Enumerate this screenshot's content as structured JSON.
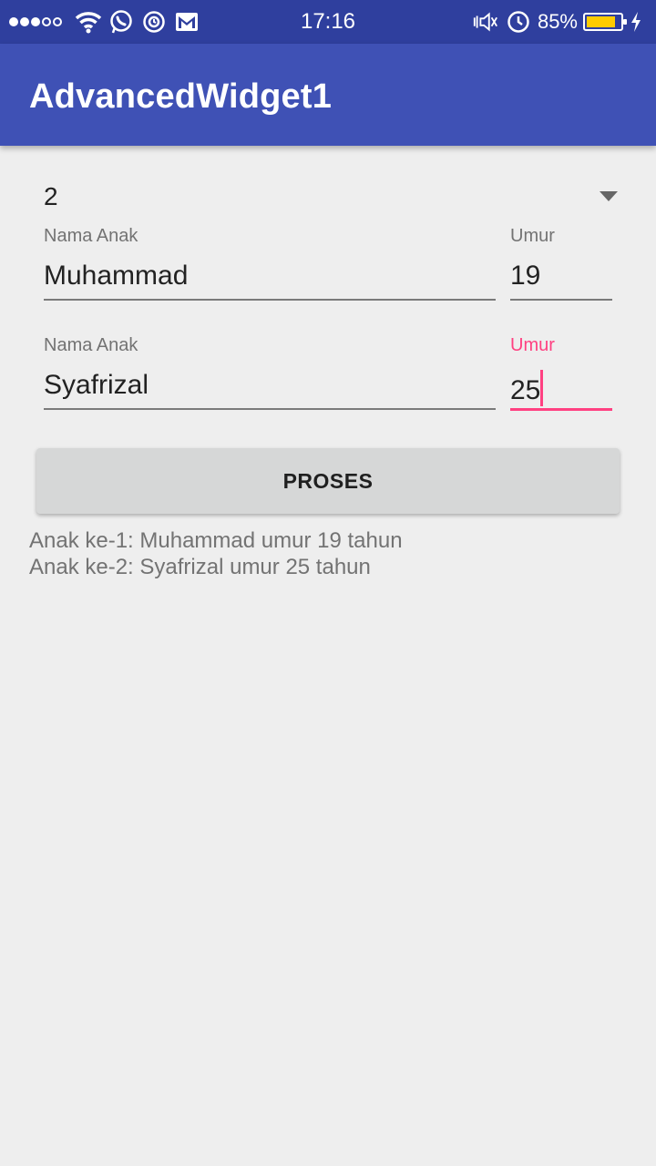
{
  "status_bar": {
    "time": "17:16",
    "battery_percent": "85%",
    "battery_level": 0.85,
    "icons_left": [
      "signal-icon",
      "wifi-icon",
      "whatsapp-icon",
      "alarm-sync-icon",
      "gmail-icon"
    ],
    "icons_right": [
      "vibrate-icon",
      "clock-icon",
      "battery-icon",
      "charging-icon"
    ]
  },
  "app_bar": {
    "title": "AdvancedWidget1"
  },
  "spinner": {
    "selected": "2"
  },
  "children": [
    {
      "name_label": "Nama Anak",
      "name_value": "Muhammad",
      "age_label": "Umur",
      "age_value": "19"
    },
    {
      "name_label": "Nama Anak",
      "name_value": "Syafrizal",
      "age_label": "Umur",
      "age_value": "25"
    }
  ],
  "button": {
    "label": "PROSES"
  },
  "results": [
    "Anak ke-1: Muhammad umur 19 tahun",
    "Anak ke-2: Syafrizal umur 25 tahun"
  ],
  "colors": {
    "status_bar": "#2f3f9e",
    "app_bar": "#3f51b5",
    "accent": "#ff4081",
    "background": "#eeeeee",
    "button": "#d6d7d7"
  }
}
